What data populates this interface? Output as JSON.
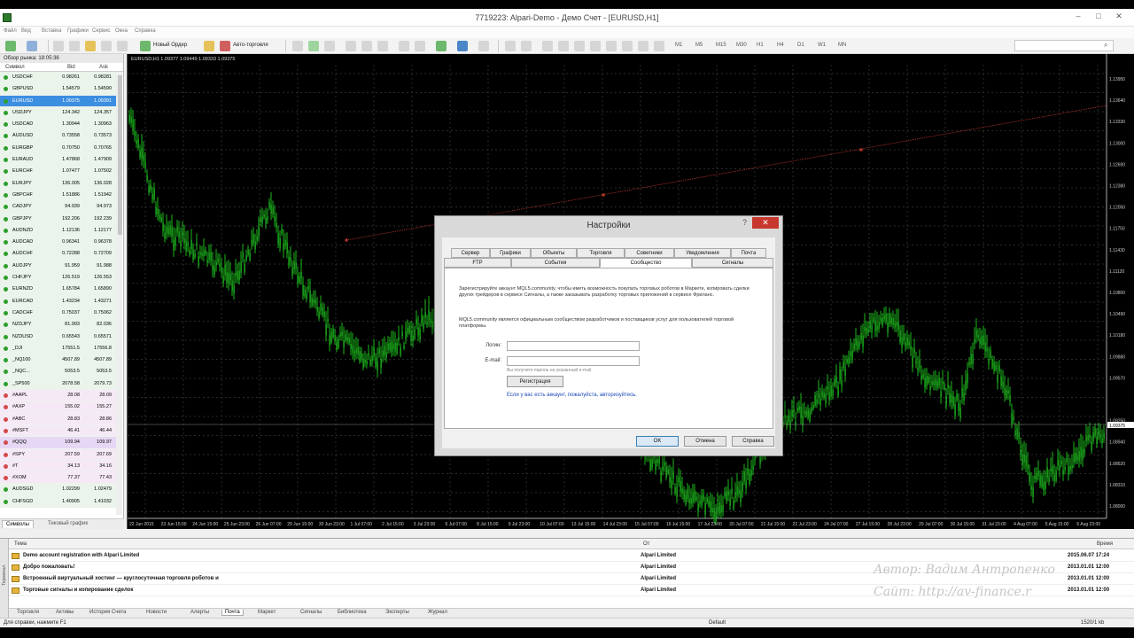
{
  "window": {
    "title": "7719223: Alpari-Demo - Демо Счет - [EURUSD,H1]",
    "menu": [
      "Файл",
      "Вид",
      "Вставка",
      "Графики",
      "Сервис",
      "Окна",
      "Справка"
    ]
  },
  "toolbar": {
    "new_order": "Новый Ордер",
    "autotrading": "Авто-торговля",
    "timeframes": [
      "M1",
      "M5",
      "M15",
      "M30",
      "H1",
      "H4",
      "D1",
      "W1",
      "MN"
    ]
  },
  "market_watch": {
    "header": "Обзор рынка: 18:05:36",
    "col_symbol": "Символ",
    "col_bid": "Bid",
    "col_ask": "Ask",
    "tabs": [
      "Символы",
      "Тиковый график"
    ],
    "rows": [
      {
        "symbol": "USDCHF",
        "bid": "0.98261",
        "ask": "0.98281",
        "bg": "#eaf4ea",
        "dot": "#2e9e2e"
      },
      {
        "symbol": "GBPUSD",
        "bid": "1.54579",
        "ask": "1.54590",
        "bg": "#eaf4ea",
        "dot": "#2e9e2e"
      },
      {
        "symbol": "EURUSD",
        "bid": "1.09375",
        "ask": "1.09391",
        "bg": "#3c8ee0",
        "dot": "#2e9e2e"
      },
      {
        "symbol": "USDJPY",
        "bid": "124.342",
        "ask": "124.357",
        "bg": "#eaf4ea",
        "dot": "#2e9e2e"
      },
      {
        "symbol": "USDCAD",
        "bid": "1.30944",
        "ask": "1.30963",
        "bg": "#eaf4ea",
        "dot": "#2e9e2e"
      },
      {
        "symbol": "AUDUSD",
        "bid": "0.73558",
        "ask": "0.73573",
        "bg": "#eaf4ea",
        "dot": "#2e9e2e"
      },
      {
        "symbol": "EURGBP",
        "bid": "0.70750",
        "ask": "0.70765",
        "bg": "#eaf4ea",
        "dot": "#2e9e2e"
      },
      {
        "symbol": "EURAUD",
        "bid": "1.47868",
        "ask": "1.47909",
        "bg": "#eaf4ea",
        "dot": "#2e9e2e"
      },
      {
        "symbol": "EURCHF",
        "bid": "1.07477",
        "ask": "1.07502",
        "bg": "#eaf4ea",
        "dot": "#2e9e2e"
      },
      {
        "symbol": "EURJPY",
        "bid": "136.005",
        "ask": "136.028",
        "bg": "#eaf4ea",
        "dot": "#2e9e2e"
      },
      {
        "symbol": "GBPCHF",
        "bid": "1.51886",
        "ask": "1.51942",
        "bg": "#eaf4ea",
        "dot": "#2e9e2e"
      },
      {
        "symbol": "CADJPY",
        "bid": "94.939",
        "ask": "94.973",
        "bg": "#eaf4ea",
        "dot": "#2e9e2e"
      },
      {
        "symbol": "GBPJPY",
        "bid": "192.206",
        "ask": "192.239",
        "bg": "#eaf4ea",
        "dot": "#2e9e2e"
      },
      {
        "symbol": "AUDNZD",
        "bid": "1.12136",
        "ask": "1.12177",
        "bg": "#eaf4ea",
        "dot": "#2e9e2e"
      },
      {
        "symbol": "AUDCAD",
        "bid": "0.96341",
        "ask": "0.96378",
        "bg": "#eaf4ea",
        "dot": "#2e9e2e"
      },
      {
        "symbol": "AUDCHF",
        "bid": "0.72288",
        "ask": "0.72709",
        "bg": "#eaf4ea",
        "dot": "#2e9e2e"
      },
      {
        "symbol": "AUDJPY",
        "bid": "91.959",
        "ask": "91.988",
        "bg": "#eaf4ea",
        "dot": "#2e9e2e"
      },
      {
        "symbol": "CHFJPY",
        "bid": "126.519",
        "ask": "126.553",
        "bg": "#eaf4ea",
        "dot": "#2e9e2e"
      },
      {
        "symbol": "EURNZD",
        "bid": "1.65784",
        "ask": "1.65890",
        "bg": "#eaf4ea",
        "dot": "#2e9e2e"
      },
      {
        "symbol": "EURCAD",
        "bid": "1.43234",
        "ask": "1.43271",
        "bg": "#eaf4ea",
        "dot": "#2e9e2e"
      },
      {
        "symbol": "CADCHF",
        "bid": "0.75037",
        "ask": "0.75062",
        "bg": "#eaf4ea",
        "dot": "#2e9e2e"
      },
      {
        "symbol": "NZDJPY",
        "bid": "81.993",
        "ask": "82.036",
        "bg": "#eaf4ea",
        "dot": "#2e9e2e"
      },
      {
        "symbol": "NZDUSD",
        "bid": "0.65543",
        "ask": "0.65571",
        "bg": "#eaf4ea",
        "dot": "#2e9e2e"
      },
      {
        "symbol": "_DJI",
        "bid": "17551.5",
        "ask": "17556.8",
        "bg": "#eaf4ea",
        "dot": "#2e9e2e"
      },
      {
        "symbol": "_NQ100",
        "bid": "4507.89",
        "ask": "4507.89",
        "bg": "#eaf4ea",
        "dot": "#2e9e2e"
      },
      {
        "symbol": "_NQC...",
        "bid": "5053.5",
        "ask": "5053.5",
        "bg": "#eaf4ea",
        "dot": "#2e9e2e"
      },
      {
        "symbol": "_SP500",
        "bid": "2078.58",
        "ask": "2079.73",
        "bg": "#eaf4ea",
        "dot": "#2e9e2e"
      },
      {
        "symbol": "#AAPL",
        "bid": "28.08",
        "ask": "28.09",
        "bg": "#f6e9f6",
        "dot": "#d24a4a"
      },
      {
        "symbol": "#AXP",
        "bid": "155.02",
        "ask": "155.27",
        "bg": "#f6e9f6",
        "dot": "#d24a4a"
      },
      {
        "symbol": "#ABC",
        "bid": "28.83",
        "ask": "28.86",
        "bg": "#f6e9f6",
        "dot": "#d24a4a"
      },
      {
        "symbol": "#MSFT",
        "bid": "46.41",
        "ask": "46.44",
        "bg": "#f6e9f6",
        "dot": "#d24a4a"
      },
      {
        "symbol": "#QQQ",
        "bid": "109.94",
        "ask": "109.97",
        "bg": "#e6d8f4",
        "dot": "#d24a4a"
      },
      {
        "symbol": "#SPY",
        "bid": "207.59",
        "ask": "207.69",
        "bg": "#f6e9f6",
        "dot": "#d24a4a"
      },
      {
        "symbol": "#T",
        "bid": "34.13",
        "ask": "34.16",
        "bg": "#f6e9f6",
        "dot": "#d24a4a"
      },
      {
        "symbol": "#XOM",
        "bid": "77.37",
        "ask": "77.43",
        "bg": "#f6e9f6",
        "dot": "#d24a4a"
      },
      {
        "symbol": "AUDSGD",
        "bid": "1.02299",
        "ask": "1.02479",
        "bg": "#eaf4ea",
        "dot": "#2e9e2e"
      },
      {
        "symbol": "CHFSGD",
        "bid": "1.40905",
        "ask": "1.41032",
        "bg": "#eaf4ea",
        "dot": "#2e9e2e"
      }
    ]
  },
  "chart": {
    "info": "EURUSD,H1  1.09377 1.09449 1.09333 1.09375",
    "bg_color": "#000000",
    "candle_color": "#1db81d",
    "trendline_color": "#c0392b",
    "price_labels": [
      "1.13950",
      "1.13640",
      "1.13330",
      "1.13000",
      "1.12690",
      "1.12380",
      "1.12050",
      "1.11750",
      "1.11430",
      "1.11120",
      "1.10800",
      "1.10490",
      "1.10180",
      "1.09880",
      "1.09570",
      "1.09375",
      "1.09250",
      "1.08940",
      "1.08620",
      "1.08310",
      "1.08000"
    ],
    "time_labels": [
      "22 Jun 2015",
      "23 Jun 15:00",
      "24 Jun 15:00",
      "25 Jun 23:00",
      "26 Jun 07:00",
      "29 Jun 15:00",
      "30 Jun 23:00",
      "1 Jul 07:00",
      "2 Jul 15:00",
      "3 Jul 23:00",
      "6 Jul 07:00",
      "8 Jul 15:00",
      "9 Jul 23:00",
      "10 Jul 07:00",
      "13 Jul 15:00",
      "14 Jul 23:00",
      "15 Jul 07:00",
      "16 Jul 15:00",
      "17 Jul 23:00",
      "20 Jul 07:00",
      "21 Jul 15:00",
      "22 Jul 23:00",
      "24 Jul 07:00",
      "27 Jul 15:00",
      "28 Jul 23:00",
      "29 Jul 07:00",
      "30 Jul 15:00",
      "31 Jul 23:00",
      "4 Aug 07:00",
      "5 Aug 15:00",
      "6 Aug 23:00"
    ]
  },
  "dialog": {
    "title": "Настройки",
    "help": "?",
    "close": "✕",
    "tabs_row1": [
      "Сервер",
      "Графики",
      "Объекты",
      "Торговля",
      "Советники",
      "Уведомления",
      "Почта"
    ],
    "tabs_row2": [
      "FTP",
      "События",
      "Сообщество",
      "Сигналы"
    ],
    "active_tab": "Сообщество",
    "text1": "Зарегистрируйте аккаунт MQL5.community, чтобы иметь возможность покупать торговых роботов в Маркете, копировать сделки других трейдеров в сервисе Сигналы, а также заказывать разработку торговых приложений в сервисе Фриланс.",
    "text2": "MQL5.community является официальным сообществом разработчиков и поставщиков услуг для пользователей торговой платформы.",
    "login_label": "Логин:",
    "email_label": "E-mail:",
    "email_hint": "Вы получите пароль на указанный e-mail.",
    "register": "Регистрация",
    "already_link": "Если у вас есть аккаунт, пожалуйста, авторизуйтесь.",
    "ok": "OK",
    "cancel": "Отмена",
    "help_btn": "Справка"
  },
  "terminal": {
    "side": [
      "Терминал"
    ],
    "col_subject": "Тема",
    "col_from": "От",
    "col_time": "Время",
    "rows": [
      {
        "subject": "Demo account registration with Alpari Limited",
        "from": "Alpari Limited",
        "time": "2015.06.07 17:24"
      },
      {
        "subject": "Добро пожаловать!",
        "from": "Alpari Limited",
        "time": "2013.01.01 12:00"
      },
      {
        "subject": "Встроенный виртуальный хостинг — круглосуточная торговля роботов и",
        "from": "Alpari Limited",
        "time": "2013.01.01 12:00"
      },
      {
        "subject": "Торговые сигналы и копирование сделок",
        "from": "Alpari Limited",
        "time": "2013.01.01 12:00"
      }
    ],
    "tabs": [
      "Торговля",
      "Активы",
      "История Счета",
      "Новости",
      "Алерты",
      "Почта",
      "Маркет",
      "Сигналы",
      "Библиотека",
      "Эксперты",
      "Журнал"
    ],
    "active_tab": "Почта",
    "watermark1": "Автор: Вадим Антропенко",
    "watermark2": "Сайт: http://av-finance.r"
  },
  "status": {
    "hint": "Для справки, нажмите F1",
    "profile": "Default",
    "traffic": "1520/1 kb"
  }
}
